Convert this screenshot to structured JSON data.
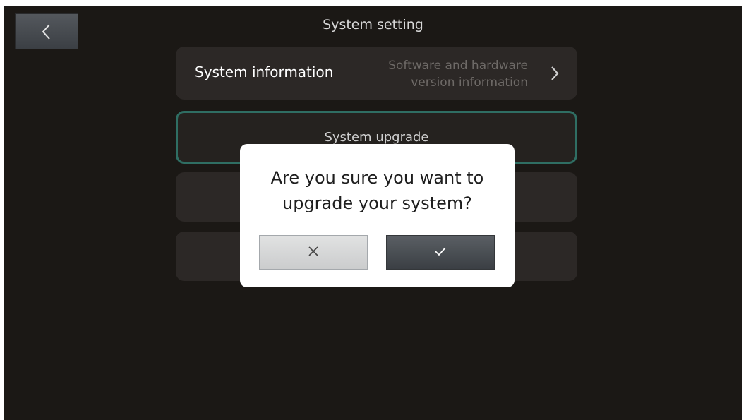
{
  "header": {
    "title": "System setting",
    "back_icon": "chevron-left-icon"
  },
  "menu": {
    "items": [
      {
        "label": "System information",
        "description_line1": "Software and hardware",
        "description_line2": "version information",
        "icon": "chevron-right-icon"
      },
      {
        "label": "System upgrade",
        "selected": true
      },
      {
        "label": ""
      },
      {
        "label": ""
      }
    ]
  },
  "dialog": {
    "message_line1": "Are you sure you want to",
    "message_line2": "upgrade your system?",
    "cancel_icon": "close-icon",
    "confirm_icon": "checkmark-icon"
  },
  "colors": {
    "background": "#1b1815",
    "menu_item": "#2c2826",
    "selected_border": "#2f6e63",
    "dialog_background": "#ffffff",
    "confirm_button": "#3b3f44",
    "cancel_button": "#d6d7d8"
  }
}
